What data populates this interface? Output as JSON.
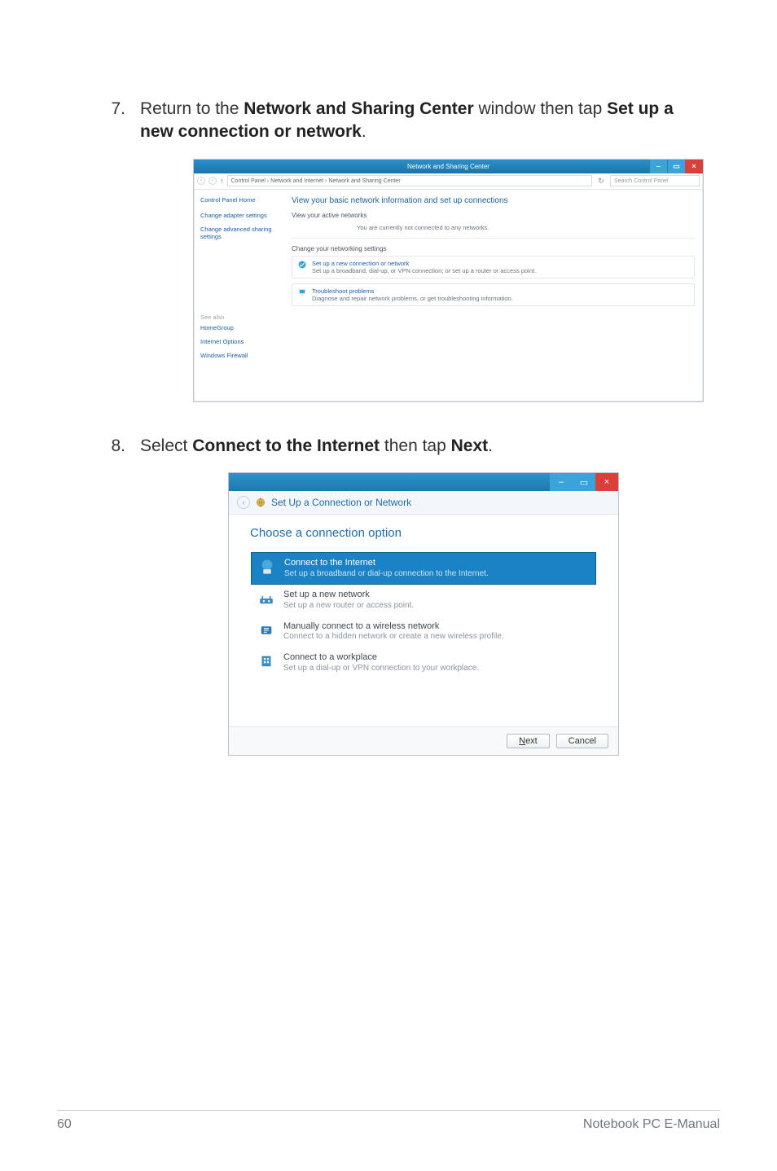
{
  "steps": {
    "s7": {
      "number": "7.",
      "textPart1": "Return to the ",
      "bold1": "Network and Sharing Center",
      "textPart2": " window then tap ",
      "bold2": "Set up a new connection or network",
      "textPart3": "."
    },
    "s8": {
      "number": "8.",
      "textPart1": "Select ",
      "bold1": "Connect to the Internet",
      "textPart2": " then tap ",
      "bold2": "Next",
      "textPart3": "."
    }
  },
  "cpWindow": {
    "title": "Network and Sharing Center",
    "breadcrumb": "Control Panel  ›  Network and Internet  ›  Network and Sharing Center",
    "searchPlaceholder": "Search Control Panel",
    "refreshLabel": "↻",
    "sidebar": {
      "home": "Control Panel Home",
      "link1": "Change adapter settings",
      "link2": "Change advanced sharing settings",
      "alsoTitle": "See also",
      "also1": "HomeGroup",
      "also2": "Internet Options",
      "also3": "Windows Firewall"
    },
    "main": {
      "heading": "View your basic network information and set up connections",
      "activeTitle": "View your active networks",
      "activeMsg": "You are currently not connected to any networks.",
      "changeTitle": "Change your networking settings",
      "row1Link": "Set up a new connection or network",
      "row1Sub": "Set up a broadband, dial-up, or VPN connection; or set up a router or access point.",
      "row2Link": "Troubleshoot problems",
      "row2Sub": "Diagnose and repair network problems, or get troubleshooting information."
    },
    "winButtons": {
      "min": "–",
      "max": "▭",
      "close": "×"
    }
  },
  "wizard": {
    "headerText": "Set Up a Connection or Network",
    "title": "Choose a connection option",
    "options": {
      "o1": {
        "title": "Connect to the Internet",
        "sub": "Set up a broadband or dial-up connection to the Internet."
      },
      "o2": {
        "title": "Set up a new network",
        "sub": "Set up a new router or access point."
      },
      "o3": {
        "title": "Manually connect to a wireless network",
        "sub": "Connect to a hidden network or create a new wireless profile."
      },
      "o4": {
        "title": "Connect to a workplace",
        "sub": "Set up a dial-up or VPN connection to your workplace."
      }
    },
    "buttons": {
      "nextPrefix": "N",
      "nextRest": "ext",
      "cancel": "Cancel"
    },
    "winButtons": {
      "min": "–",
      "max": "▭",
      "close": "×"
    }
  },
  "footer": {
    "pageNum": "60",
    "title": "Notebook PC E-Manual"
  }
}
